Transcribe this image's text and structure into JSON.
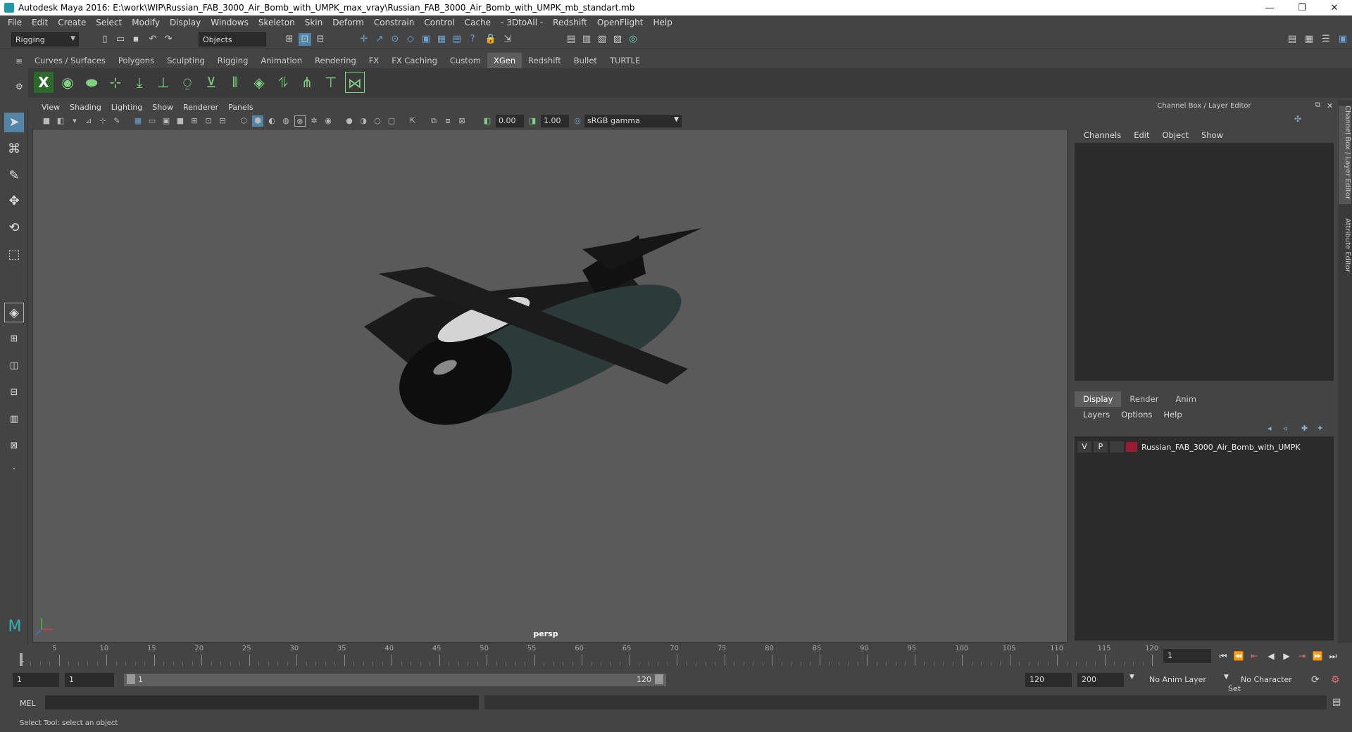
{
  "window": {
    "title": "Autodesk Maya 2016: E:\\work\\WIP\\Russian_FAB_3000_Air_Bomb_with_UMPK_max_vray\\Russian_FAB_3000_Air_Bomb_with_UMPK_mb_standart.mb",
    "minimize": "—",
    "restore": "❐",
    "close": "✕"
  },
  "menu": [
    "File",
    "Edit",
    "Create",
    "Select",
    "Modify",
    "Display",
    "Windows",
    "Skeleton",
    "Skin",
    "Deform",
    "Constrain",
    "Control",
    "Cache",
    "- 3DtoAll -",
    "Redshift",
    "OpenFlight",
    "Help"
  ],
  "status_line": {
    "mode": "Rigging",
    "selection_mask": "Objects"
  },
  "shelf_tabs": [
    "Curves / Surfaces",
    "Polygons",
    "Sculpting",
    "Rigging",
    "Animation",
    "Rendering",
    "FX",
    "FX Caching",
    "Custom",
    "XGen",
    "Redshift",
    "Bullet",
    "TURTLE"
  ],
  "active_shelf_tab": "XGen",
  "viewport": {
    "menu": [
      "View",
      "Shading",
      "Lighting",
      "Show",
      "Renderer",
      "Panels"
    ],
    "exposure": "0.00",
    "gamma": "1.00",
    "color_space": "sRGB gamma",
    "camera_label": "persp"
  },
  "channel_box": {
    "title": "Channel Box / Layer Editor",
    "menu": [
      "Channels",
      "Edit",
      "Object",
      "Show"
    ]
  },
  "layer_editor": {
    "tabs": [
      "Display",
      "Render",
      "Anim"
    ],
    "active_tab": "Display",
    "menu": [
      "Layers",
      "Options",
      "Help"
    ],
    "layers": [
      {
        "visible": "V",
        "playback": "P",
        "name": "Russian_FAB_3000_Air_Bomb_with_UMPK",
        "color": "#9b1b30"
      }
    ]
  },
  "side_tabs": [
    "Channel Box / Layer Editor",
    "Attribute Editor"
  ],
  "timeline": {
    "ticks": [
      "1",
      "5",
      "10",
      "15",
      "20",
      "25",
      "30",
      "35",
      "40",
      "45",
      "50",
      "55",
      "60",
      "65",
      "70",
      "75",
      "80",
      "85",
      "90",
      "95",
      "100",
      "105",
      "110",
      "115",
      "120"
    ],
    "current_frame": "1"
  },
  "range": {
    "start": "1",
    "playback_start": "1",
    "slider_start": "1",
    "slider_end": "120",
    "playback_end": "120",
    "end": "200",
    "anim_layer": "No Anim Layer",
    "character_set": "No Character Set"
  },
  "command_line": {
    "label": "MEL"
  },
  "help_line": "Select Tool: select an object",
  "colors": {
    "accent": "#5285a6",
    "shelf_icon": "#7fd07f",
    "viewport_bg": "#5a5a5a"
  }
}
